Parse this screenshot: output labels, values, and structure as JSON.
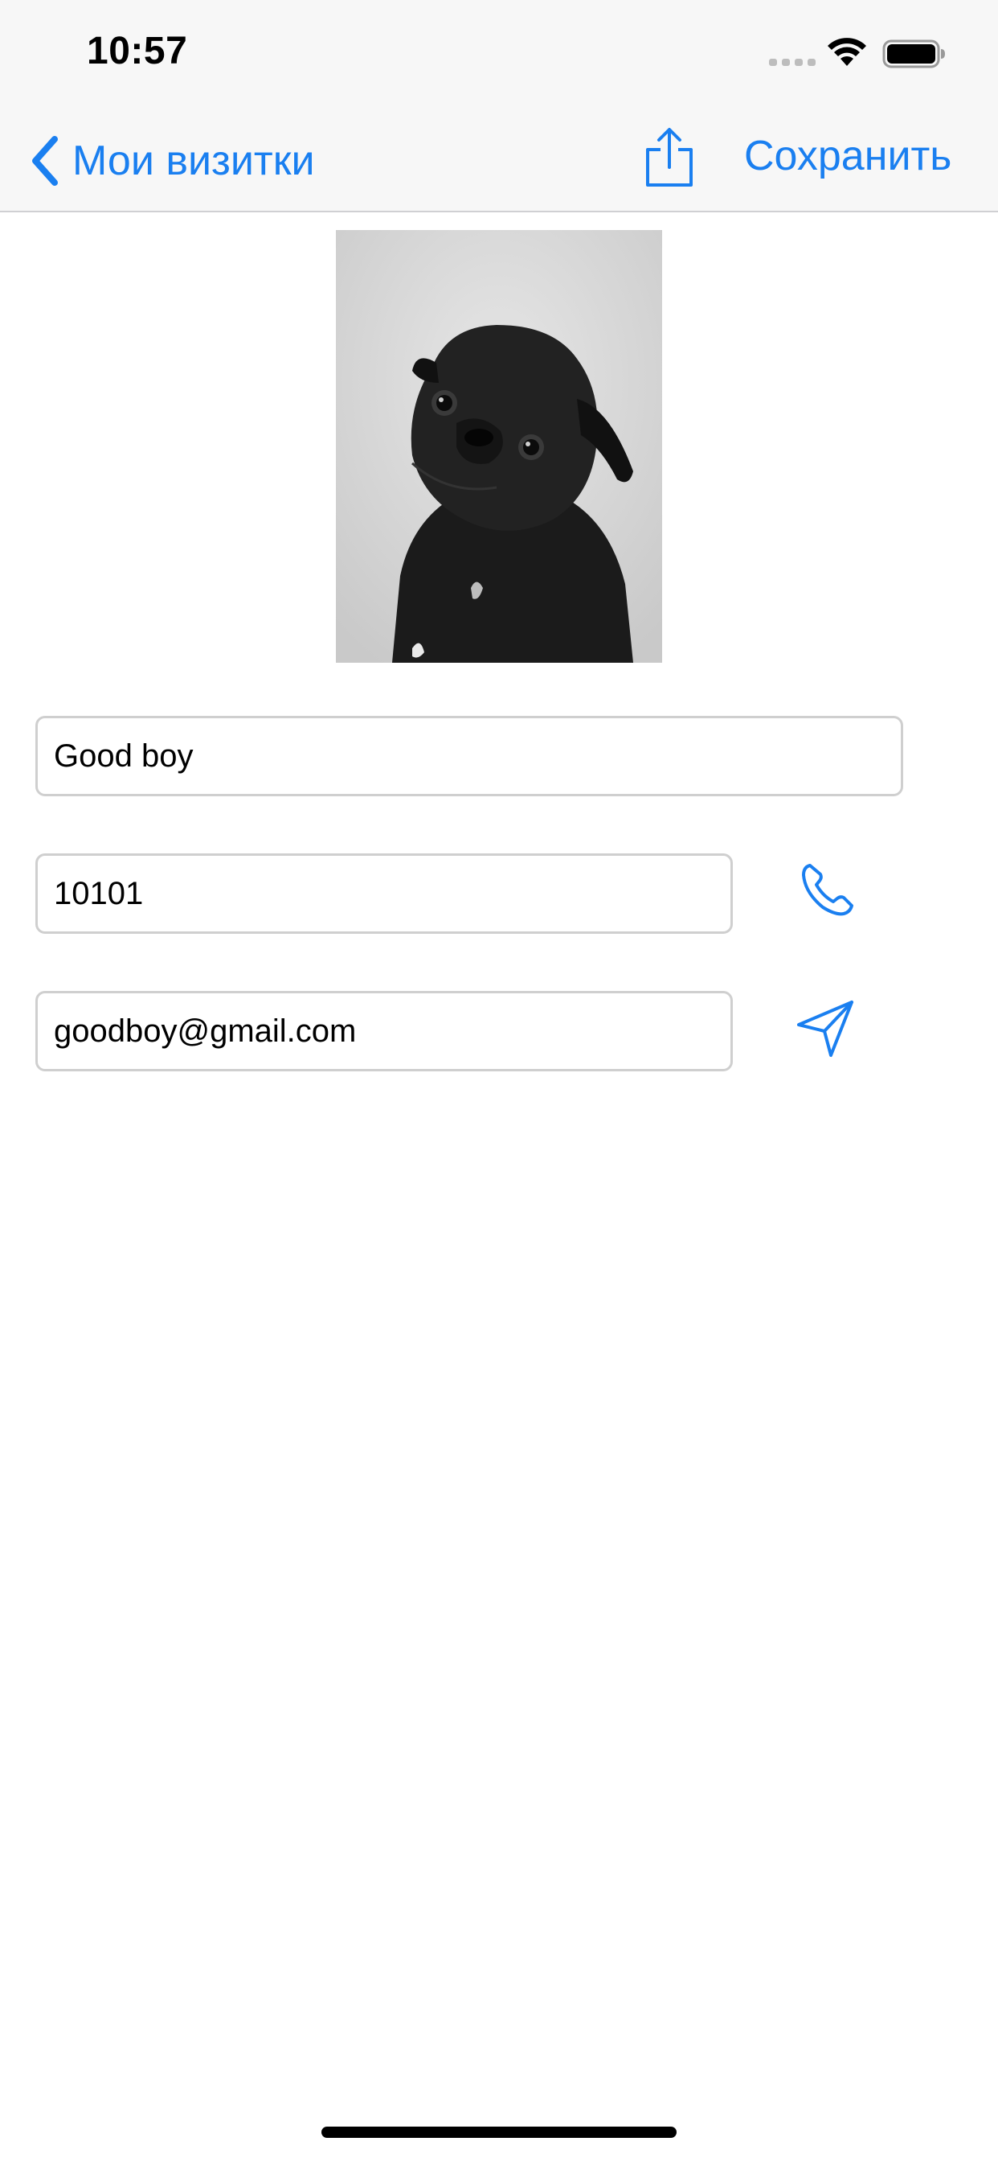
{
  "status_bar": {
    "time": "10:57"
  },
  "nav": {
    "back_label": "Мои визитки",
    "save_label": "Сохранить"
  },
  "card": {
    "name": "Good boy",
    "phone": "10101",
    "email": "goodboy@gmail.com"
  },
  "colors": {
    "accent": "#1a7ff0",
    "field_border": "#cfcfcf",
    "nav_background": "#f7f7f7"
  },
  "icons": {
    "back": "chevron-left-icon",
    "share": "share-icon",
    "phone": "phone-icon",
    "send": "paper-plane-icon"
  }
}
